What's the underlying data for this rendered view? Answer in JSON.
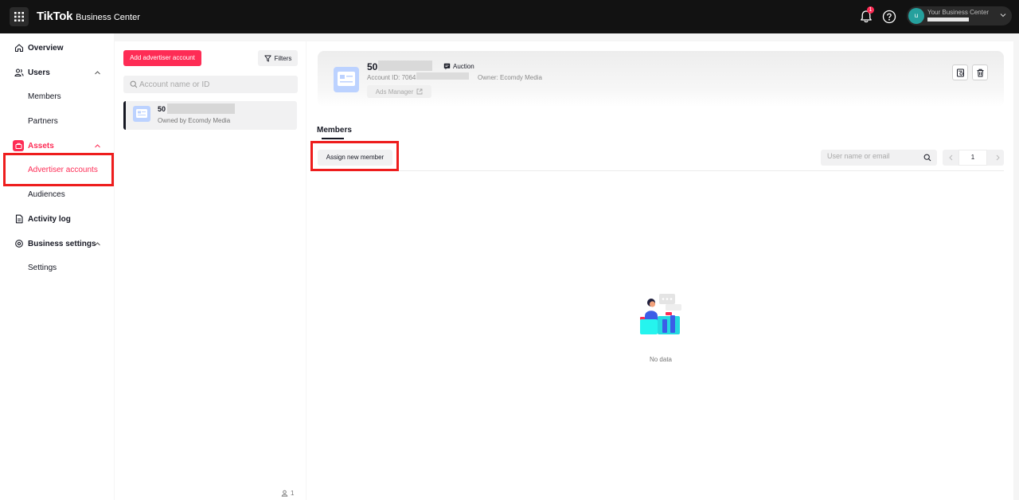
{
  "topbar": {
    "brand": "TikTok",
    "brand_sub": "Business Center",
    "notification_count": "1",
    "account_avatar": "u",
    "account_name": "Your Business Center"
  },
  "sidebar": {
    "items": [
      {
        "label": "Overview",
        "icon": "home-icon"
      },
      {
        "label": "Users",
        "icon": "users-icon"
      },
      {
        "label": "Members"
      },
      {
        "label": "Partners"
      },
      {
        "label": "Assets",
        "icon": "assets-icon"
      },
      {
        "label": "Advertiser accounts"
      },
      {
        "label": "Audiences"
      },
      {
        "label": "Activity log",
        "icon": "document-icon"
      },
      {
        "label": "Business settings",
        "icon": "settings-icon"
      },
      {
        "label": "Settings"
      }
    ]
  },
  "list_panel": {
    "add_button": "Add advertiser account",
    "filters_button": "Filters",
    "search_placeholder": "Account name or ID",
    "account": {
      "name": "50",
      "owner": "Owned by Ecomdy Media"
    },
    "member_count": "1"
  },
  "detail": {
    "name": "50",
    "type": "Auction",
    "account_id_label": "Account ID: 7064",
    "owner": "Owner: Ecomdy Media",
    "ads_manager_button": "Ads Manager",
    "tab_members": "Members",
    "assign_button": "Assign new member",
    "member_search_placeholder": "User name or email",
    "page_number": "1",
    "empty_text": "No data"
  },
  "colors": {
    "brand": "#fe2c55",
    "highlight": "#ee1d1d",
    "topbar": "#121212"
  }
}
